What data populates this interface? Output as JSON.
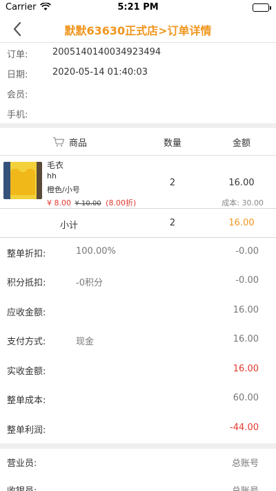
{
  "status": {
    "carrier": "Carrier",
    "time": "5:21 PM"
  },
  "nav": {
    "title": "默默63630正式店>订单详情"
  },
  "order_info": [
    {
      "label": "订单:",
      "value": "2005140140034923494"
    },
    {
      "label": "日期:",
      "value": "2020-05-14 01:40:03"
    },
    {
      "label": "会员:",
      "value": ""
    },
    {
      "label": "手机:",
      "value": ""
    }
  ],
  "table": {
    "headers": {
      "product": "商品",
      "quantity": "数量",
      "amount": "金额"
    },
    "item": {
      "name": "毛衣",
      "sku": "hh",
      "spec": "橙色/小号",
      "price": "¥ 8.00",
      "original_price": "¥ 10.00",
      "discount": "(8.00折)",
      "quantity": "2",
      "amount": "16.00",
      "cost": "成本: 30.00"
    },
    "subtotal": {
      "label": "小计",
      "quantity": "2",
      "amount": "16.00"
    }
  },
  "summary": [
    {
      "label": "整单折扣:",
      "middle": "100.00%",
      "value": "-0.00"
    },
    {
      "label": "积分抵扣:",
      "middle": "-0积分",
      "value": "-0.00"
    },
    {
      "label": "应收金额:",
      "middle": "",
      "value": "16.00"
    },
    {
      "label": "支付方式:",
      "middle": "现金",
      "value": "16.00"
    },
    {
      "label": "实收金额:",
      "middle": "",
      "value": "16.00"
    },
    {
      "label": "整单成本:",
      "middle": "",
      "value": "60.00"
    },
    {
      "label": "整单利润:",
      "middle": "",
      "value": "-44.00"
    }
  ],
  "staff": [
    {
      "label": "营业员:",
      "value": "总账号"
    },
    {
      "label": "收银员:",
      "value": "总账号"
    }
  ],
  "colors": {
    "accent": "#f0961e",
    "negative": "#e2392f"
  },
  "icons": {
    "back": "chevron-left-icon",
    "cart": "cart-icon",
    "wifi": "wifi-icon",
    "battery": "battery-icon"
  }
}
